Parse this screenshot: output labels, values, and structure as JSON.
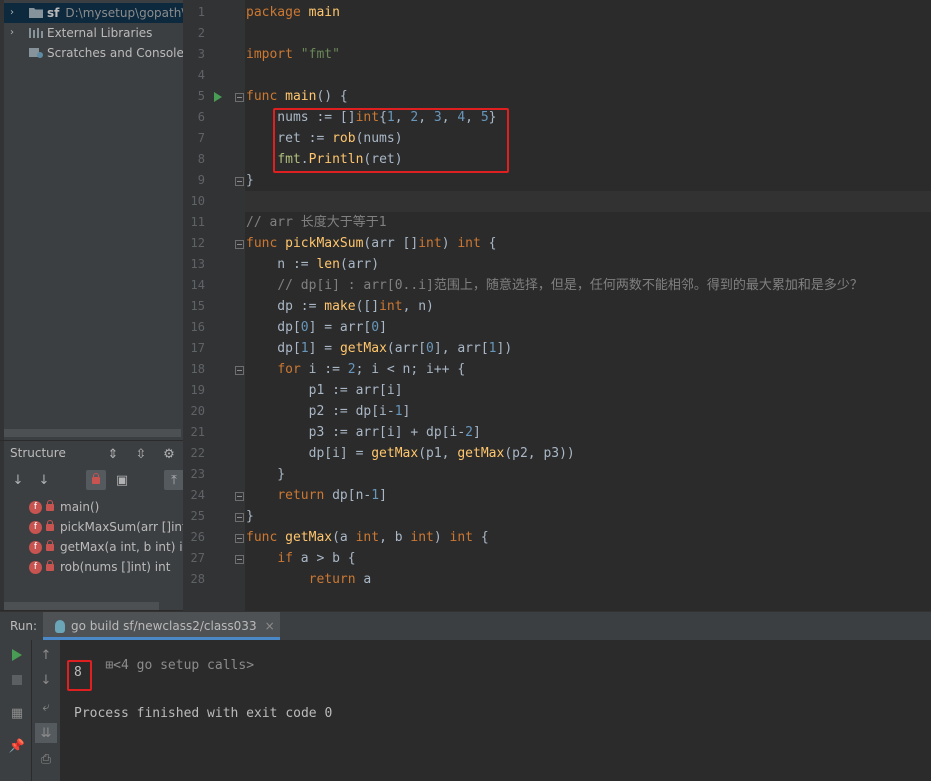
{
  "project_tree": {
    "items": [
      {
        "arrow": "›",
        "label": "sf",
        "path": "D:\\mysetup\\gopath\\",
        "selected": true
      },
      {
        "arrow": "›",
        "label": "External Libraries",
        "path": ""
      },
      {
        "arrow": "",
        "label": "Scratches and Consoles",
        "path": ""
      }
    ]
  },
  "structure": {
    "title": "Structure",
    "items": [
      {
        "badge": "f",
        "label": "main()"
      },
      {
        "badge": "f",
        "label": "pickMaxSum(arr []int"
      },
      {
        "badge": "f",
        "label": "getMax(a int, b int) i"
      },
      {
        "badge": "f",
        "label": "rob(nums []int) int"
      }
    ]
  },
  "editor": {
    "line_numbers": [
      "1",
      "2",
      "3",
      "4",
      "5",
      "6",
      "7",
      "8",
      "9",
      "10",
      "11",
      "12",
      "13",
      "14",
      "15",
      "16",
      "17",
      "18",
      "19",
      "20",
      "21",
      "22",
      "23",
      "24",
      "25",
      "26",
      "27",
      "28"
    ],
    "current_line": "10",
    "lines": [
      "package main",
      "",
      "import \"fmt\"",
      "",
      "func main() {",
      "    nums := []int{1, 2, 3, 4, 5}",
      "    ret := rob(nums)",
      "    fmt.Println(ret)",
      "}",
      "",
      "// arr 长度大于等于1",
      "func pickMaxSum(arr []int) int {",
      "    n := len(arr)",
      "    // dp[i] : arr[0..i]范围上，随意选择，但是，任何两数不能相邻。得到的最大累加和是多少？",
      "    dp := make([]int, n)",
      "    dp[0] = arr[0]",
      "    dp[1] = getMax(arr[0], arr[1])",
      "    for i := 2; i < n; i++ {",
      "        p1 := arr[i]",
      "        p2 := dp[i-1]",
      "        p3 := arr[i] + dp[i-2]",
      "        dp[i] = getMax(p1, getMax(p2, p3))",
      "    }",
      "    return dp[n-1]",
      "}",
      "func getMax(a int, b int) int {",
      "    if a > b {",
      "        return a"
    ]
  },
  "run": {
    "label": "Run:",
    "tab_title": "go build sf/newclass2/class033",
    "tab_close": "×",
    "console": {
      "fold_text": "<4 go setup calls>",
      "output": "8",
      "finish": "Process finished with exit code 0"
    }
  },
  "colors": {
    "keyword": "#cc7832",
    "string": "#6a8759",
    "number": "#6897bb",
    "function": "#ffc66d",
    "comment": "#808080",
    "highlight_border": "#e02020"
  }
}
